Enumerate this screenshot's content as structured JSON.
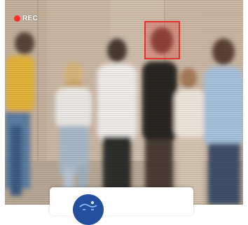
{
  "recording": {
    "label": "REC",
    "indicator_color": "#ff2a2a"
  },
  "detection": {
    "box_color": "#e0312d"
  },
  "card": {
    "icon": "face-scan-icon",
    "accent": "#234f9e"
  }
}
